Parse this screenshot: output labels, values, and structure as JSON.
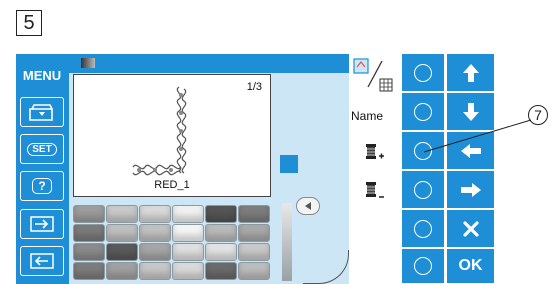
{
  "step_number": "5",
  "left_panel": {
    "menu_label": "MENU",
    "set_label": "SET",
    "help_label": "?"
  },
  "preview": {
    "page": "1/3",
    "pattern_name": "RED_1"
  },
  "palette": {
    "rows": [
      [
        "#9c9c9c",
        "#c8c8c8",
        "#d8d8d8",
        "#f0f0f0",
        "#545454",
        "#7d7d7d"
      ],
      [
        "#7a7a7a",
        "#bfbfbf",
        "#c0c0c0",
        "#f4f4f4",
        "#b9b9b9",
        "#a8a8a8"
      ],
      [
        "#8a8a8a",
        "#5a5a5a",
        "#a5a5a5",
        "#dedede",
        "#e2e2e2",
        "#c8c8c8"
      ],
      [
        "#7c7c7c",
        "#a0a0a0",
        "#c6c6c6",
        "#d9d9d9",
        "#6a6a6a",
        "#bcbcbc"
      ]
    ]
  },
  "func_column": {
    "name_label": "Name"
  },
  "right_panel": {
    "ok_label": "OK"
  },
  "callout": "⑦",
  "colors": {
    "accent_blue": "#1e8fd6",
    "screen_bg": "#cde6f5"
  }
}
